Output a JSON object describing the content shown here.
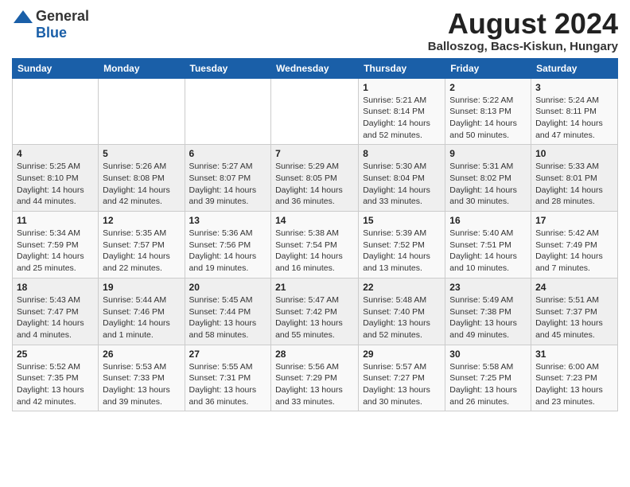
{
  "header": {
    "logo_general": "General",
    "logo_blue": "Blue",
    "month_year": "August 2024",
    "location": "Balloszog, Bacs-Kiskun, Hungary"
  },
  "weekdays": [
    "Sunday",
    "Monday",
    "Tuesday",
    "Wednesday",
    "Thursday",
    "Friday",
    "Saturday"
  ],
  "weeks": [
    [
      {
        "day": "",
        "info": ""
      },
      {
        "day": "",
        "info": ""
      },
      {
        "day": "",
        "info": ""
      },
      {
        "day": "",
        "info": ""
      },
      {
        "day": "1",
        "info": "Sunrise: 5:21 AM\nSunset: 8:14 PM\nDaylight: 14 hours\nand 52 minutes."
      },
      {
        "day": "2",
        "info": "Sunrise: 5:22 AM\nSunset: 8:13 PM\nDaylight: 14 hours\nand 50 minutes."
      },
      {
        "day": "3",
        "info": "Sunrise: 5:24 AM\nSunset: 8:11 PM\nDaylight: 14 hours\nand 47 minutes."
      }
    ],
    [
      {
        "day": "4",
        "info": "Sunrise: 5:25 AM\nSunset: 8:10 PM\nDaylight: 14 hours\nand 44 minutes."
      },
      {
        "day": "5",
        "info": "Sunrise: 5:26 AM\nSunset: 8:08 PM\nDaylight: 14 hours\nand 42 minutes."
      },
      {
        "day": "6",
        "info": "Sunrise: 5:27 AM\nSunset: 8:07 PM\nDaylight: 14 hours\nand 39 minutes."
      },
      {
        "day": "7",
        "info": "Sunrise: 5:29 AM\nSunset: 8:05 PM\nDaylight: 14 hours\nand 36 minutes."
      },
      {
        "day": "8",
        "info": "Sunrise: 5:30 AM\nSunset: 8:04 PM\nDaylight: 14 hours\nand 33 minutes."
      },
      {
        "day": "9",
        "info": "Sunrise: 5:31 AM\nSunset: 8:02 PM\nDaylight: 14 hours\nand 30 minutes."
      },
      {
        "day": "10",
        "info": "Sunrise: 5:33 AM\nSunset: 8:01 PM\nDaylight: 14 hours\nand 28 minutes."
      }
    ],
    [
      {
        "day": "11",
        "info": "Sunrise: 5:34 AM\nSunset: 7:59 PM\nDaylight: 14 hours\nand 25 minutes."
      },
      {
        "day": "12",
        "info": "Sunrise: 5:35 AM\nSunset: 7:57 PM\nDaylight: 14 hours\nand 22 minutes."
      },
      {
        "day": "13",
        "info": "Sunrise: 5:36 AM\nSunset: 7:56 PM\nDaylight: 14 hours\nand 19 minutes."
      },
      {
        "day": "14",
        "info": "Sunrise: 5:38 AM\nSunset: 7:54 PM\nDaylight: 14 hours\nand 16 minutes."
      },
      {
        "day": "15",
        "info": "Sunrise: 5:39 AM\nSunset: 7:52 PM\nDaylight: 14 hours\nand 13 minutes."
      },
      {
        "day": "16",
        "info": "Sunrise: 5:40 AM\nSunset: 7:51 PM\nDaylight: 14 hours\nand 10 minutes."
      },
      {
        "day": "17",
        "info": "Sunrise: 5:42 AM\nSunset: 7:49 PM\nDaylight: 14 hours\nand 7 minutes."
      }
    ],
    [
      {
        "day": "18",
        "info": "Sunrise: 5:43 AM\nSunset: 7:47 PM\nDaylight: 14 hours\nand 4 minutes."
      },
      {
        "day": "19",
        "info": "Sunrise: 5:44 AM\nSunset: 7:46 PM\nDaylight: 14 hours\nand 1 minute."
      },
      {
        "day": "20",
        "info": "Sunrise: 5:45 AM\nSunset: 7:44 PM\nDaylight: 13 hours\nand 58 minutes."
      },
      {
        "day": "21",
        "info": "Sunrise: 5:47 AM\nSunset: 7:42 PM\nDaylight: 13 hours\nand 55 minutes."
      },
      {
        "day": "22",
        "info": "Sunrise: 5:48 AM\nSunset: 7:40 PM\nDaylight: 13 hours\nand 52 minutes."
      },
      {
        "day": "23",
        "info": "Sunrise: 5:49 AM\nSunset: 7:38 PM\nDaylight: 13 hours\nand 49 minutes."
      },
      {
        "day": "24",
        "info": "Sunrise: 5:51 AM\nSunset: 7:37 PM\nDaylight: 13 hours\nand 45 minutes."
      }
    ],
    [
      {
        "day": "25",
        "info": "Sunrise: 5:52 AM\nSunset: 7:35 PM\nDaylight: 13 hours\nand 42 minutes."
      },
      {
        "day": "26",
        "info": "Sunrise: 5:53 AM\nSunset: 7:33 PM\nDaylight: 13 hours\nand 39 minutes."
      },
      {
        "day": "27",
        "info": "Sunrise: 5:55 AM\nSunset: 7:31 PM\nDaylight: 13 hours\nand 36 minutes."
      },
      {
        "day": "28",
        "info": "Sunrise: 5:56 AM\nSunset: 7:29 PM\nDaylight: 13 hours\nand 33 minutes."
      },
      {
        "day": "29",
        "info": "Sunrise: 5:57 AM\nSunset: 7:27 PM\nDaylight: 13 hours\nand 30 minutes."
      },
      {
        "day": "30",
        "info": "Sunrise: 5:58 AM\nSunset: 7:25 PM\nDaylight: 13 hours\nand 26 minutes."
      },
      {
        "day": "31",
        "info": "Sunrise: 6:00 AM\nSunset: 7:23 PM\nDaylight: 13 hours\nand 23 minutes."
      }
    ]
  ]
}
